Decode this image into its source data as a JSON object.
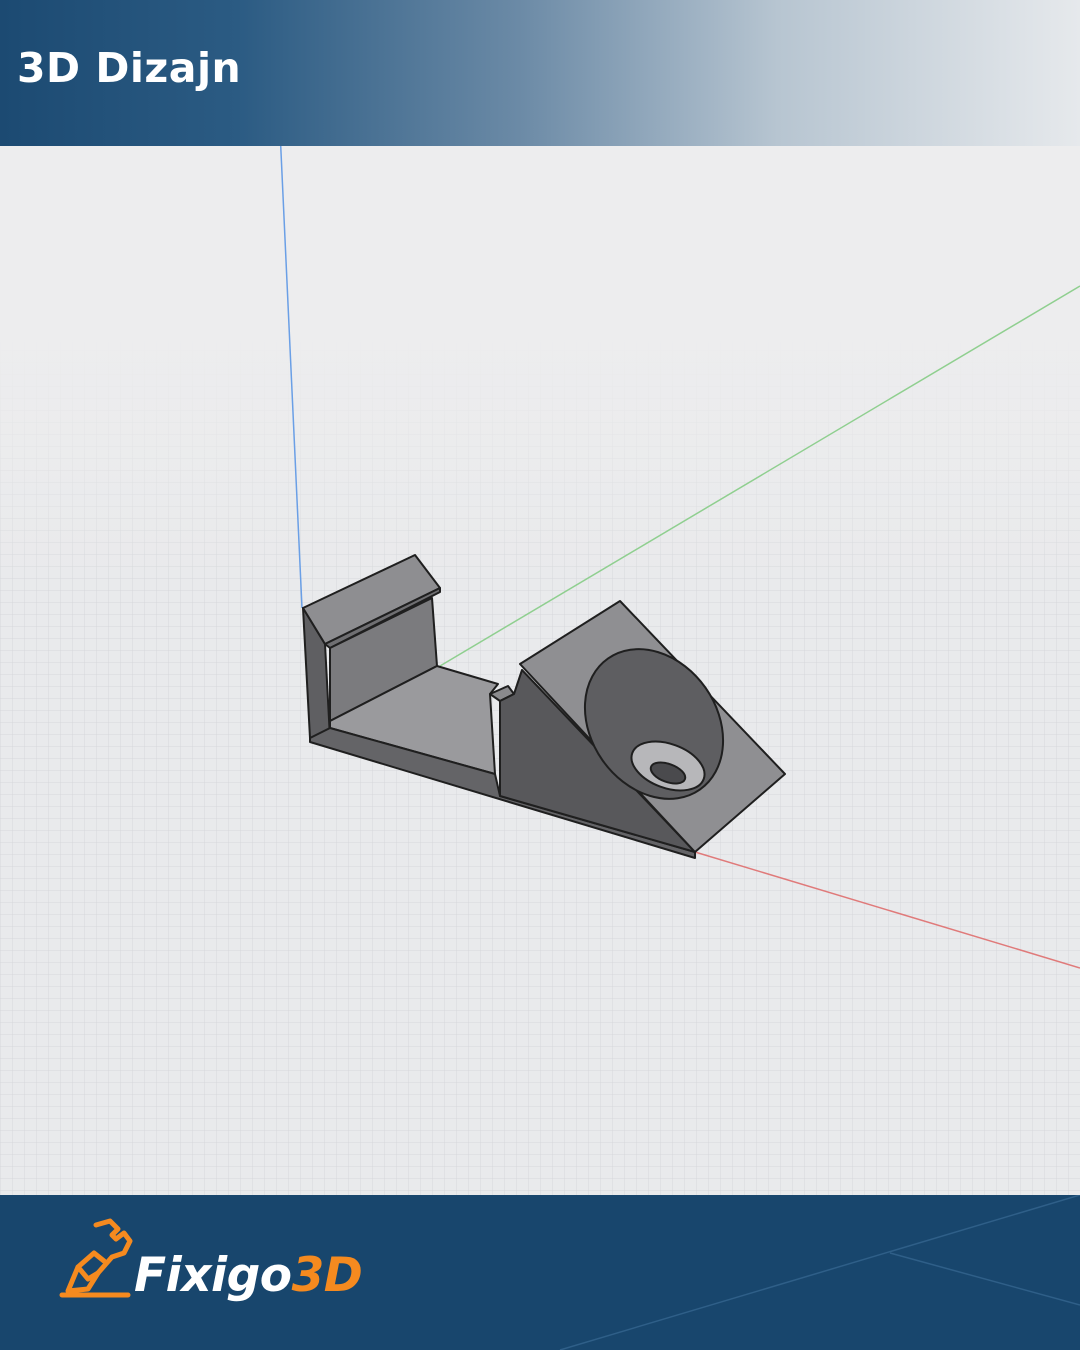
{
  "header": {
    "title": "3D Dizajn"
  },
  "brand": {
    "name_primary": "Fixigo",
    "name_accent": "3D",
    "logo_icon": "wrench-hand-icon"
  },
  "viewport": {
    "axis_colors": {
      "x": "#e07a7a",
      "y": "#8fcf8f",
      "z": "#6a9fe6"
    },
    "model_color": "#8c8c8e",
    "grid_color": "#cfd1d4"
  },
  "colors": {
    "header_dark": "#1c4a72",
    "footer_bg": "#18466d",
    "accent": "#f58a1f"
  }
}
